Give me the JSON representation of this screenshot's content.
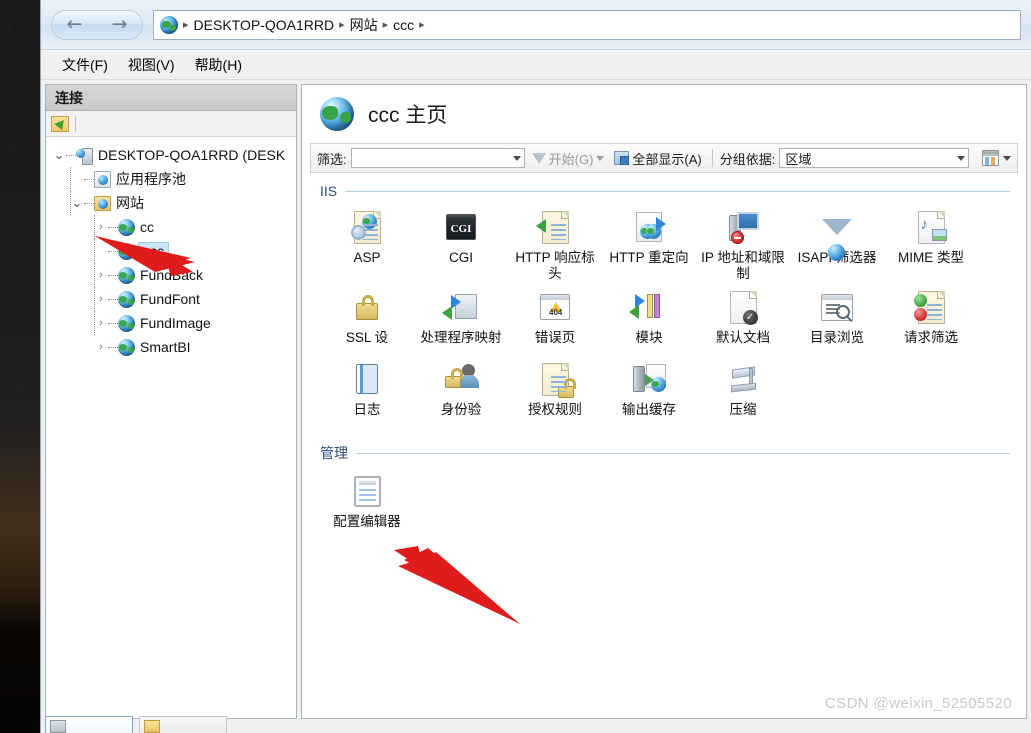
{
  "window": {
    "breadcrumb": {
      "icon": "globe-icon",
      "items": [
        "DESKTOP-QOA1RRD",
        "网站",
        "ccc"
      ],
      "separator": "▸",
      "back_label": "←",
      "forward_label": "→"
    },
    "menu": [
      {
        "label": "文件(F)",
        "accel": "F"
      },
      {
        "label": "视图(V)",
        "accel": "V"
      },
      {
        "label": "帮助(H)",
        "accel": "H"
      }
    ]
  },
  "sidebar": {
    "title": "连接",
    "toolbar": {
      "connect_icon": "connect-to-server-icon"
    },
    "tree": [
      {
        "label": "DESKTOP-QOA1RRD (DESK",
        "icon": "server-icon",
        "twisty": "⌄",
        "level": 0,
        "selected": false
      },
      {
        "label": "应用程序池",
        "icon": "application-pool-icon",
        "twisty": "",
        "level": 1,
        "selected": false
      },
      {
        "label": "网站",
        "icon": "sites-folder-icon",
        "twisty": "⌄",
        "level": 1,
        "selected": false
      },
      {
        "label": "cc",
        "icon": "website-icon",
        "twisty": "›",
        "level": 2,
        "selected": false
      },
      {
        "label": "ccc",
        "icon": "website-icon",
        "twisty": "",
        "level": 2,
        "selected": true
      },
      {
        "label": "FundBack",
        "icon": "website-icon",
        "twisty": "›",
        "level": 2,
        "selected": false
      },
      {
        "label": "FundFont",
        "icon": "website-icon",
        "twisty": "›",
        "level": 2,
        "selected": false
      },
      {
        "label": "FundImage",
        "icon": "website-icon",
        "twisty": "›",
        "level": 2,
        "selected": false
      },
      {
        "label": "SmartBI",
        "icon": "website-icon",
        "twisty": "›",
        "level": 2,
        "selected": false
      }
    ]
  },
  "page": {
    "title": "ccc 主页",
    "icon": "globe-icon"
  },
  "filterbar": {
    "filter_label": "筛选:",
    "filter_value": "",
    "go_label": "开始(G)",
    "show_all_label": "全部显示(A)",
    "group_by_label": "分组依据:",
    "group_by_value": "区域",
    "view_options_icon": "view-options-icon",
    "funnel_icon": "funnel-icon",
    "show_all_icon": "show-all-icon"
  },
  "sections": [
    {
      "name": "IIS",
      "items": [
        {
          "label": "ASP",
          "icon": "asp-icon"
        },
        {
          "label": "CGI",
          "icon": "cgi-icon"
        },
        {
          "label": "HTTP 响应标头",
          "icon": "http-response-headers-icon"
        },
        {
          "label": "HTTP 重定向",
          "icon": "http-redirect-icon"
        },
        {
          "label": "IP 地址和域限制",
          "icon": "ip-address-domain-restrictions-icon"
        },
        {
          "label": "ISAPI 筛选器",
          "icon": "isapi-filters-icon"
        },
        {
          "label": "MIME 类型",
          "icon": "mime-types-icon"
        },
        {
          "label": "SSL 设",
          "icon": "ssl-settings-icon"
        },
        {
          "label": "处理程序映射",
          "icon": "handler-mappings-icon"
        },
        {
          "label": "错误页",
          "icon": "error-pages-icon"
        },
        {
          "label": "模块",
          "icon": "modules-icon"
        },
        {
          "label": "默认文档",
          "icon": "default-document-icon"
        },
        {
          "label": "目录浏览",
          "icon": "directory-browsing-icon"
        },
        {
          "label": "请求筛选",
          "icon": "request-filtering-icon"
        },
        {
          "label": "日志",
          "icon": "logging-icon"
        },
        {
          "label": "身份验",
          "icon": "authentication-icon"
        },
        {
          "label": "授权规则",
          "icon": "authorization-rules-icon"
        },
        {
          "label": "输出缓存",
          "icon": "output-caching-icon"
        },
        {
          "label": "压缩",
          "icon": "compression-icon"
        }
      ]
    },
    {
      "name": "管理",
      "items": [
        {
          "label": "配置编辑器",
          "icon": "configuration-editor-icon"
        }
      ]
    }
  ],
  "view_tabs": [
    {
      "label": "",
      "icon": "features-view-icon",
      "active": true
    },
    {
      "label": "",
      "icon": "content-view-icon",
      "active": false
    }
  ],
  "watermark": "CSDN @weixin_52505520",
  "annotations": [
    {
      "name": "arrow-to-ccc-node",
      "color": "#e01b1b"
    },
    {
      "name": "arrow-to-configuration-editor",
      "color": "#e01b1b"
    }
  ]
}
